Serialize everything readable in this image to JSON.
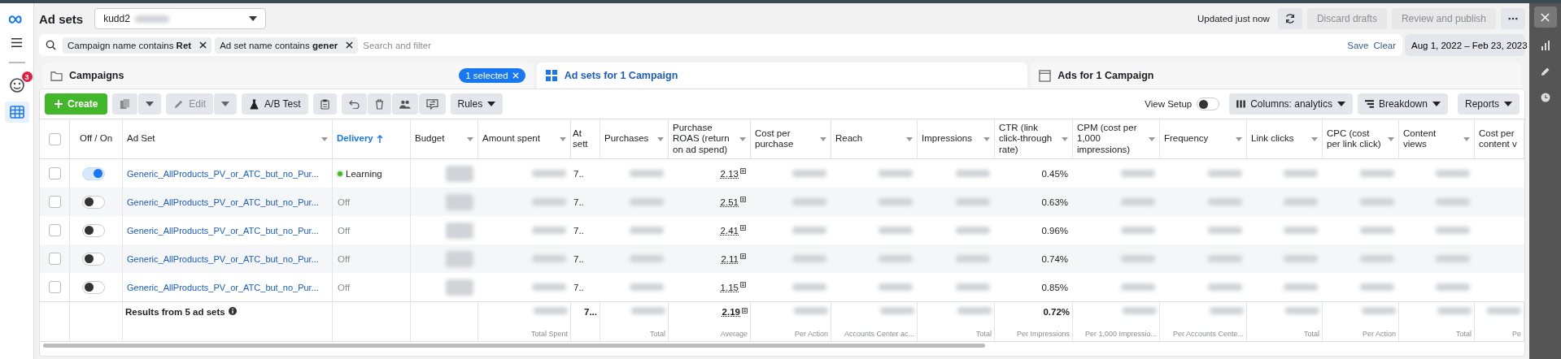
{
  "header": {
    "title": "Ad sets",
    "account": "kudd2",
    "status": "Updated just now",
    "buttons": [
      {
        "label": "Discard drafts",
        "disabled": true
      },
      {
        "label": "Review and publish",
        "disabled": true
      }
    ]
  },
  "left_nav": {
    "notification_badge": "3"
  },
  "filter": {
    "chips": [
      {
        "text": "Campaign name contains **Ret**"
      },
      {
        "text": "Ad set name contains **gener**"
      }
    ],
    "placeholder": "Search and filter",
    "links": [
      "Save",
      "Clear"
    ]
  },
  "date_range": "Aug 1, 2022 – Feb 23, 2023",
  "tabs": [
    {
      "label": "Campaigns",
      "selected": false,
      "badge": "1 selected"
    },
    {
      "label": "Ad sets for 1 Campaign",
      "selected": true
    },
    {
      "label": "Ads for 1 Campaign",
      "selected": false
    }
  ],
  "toolbar": {
    "create": "Create",
    "edit": {
      "label": "Edit",
      "disabled": true
    },
    "ab_test": "A/B Test",
    "rules": "Rules",
    "view_setup": {
      "label": "View Setup",
      "on": false
    },
    "columns": "Columns: analytics",
    "breakdown": "Breakdown",
    "reports": "Reports"
  },
  "columns": [
    {
      "label": "Off / On",
      "sorted": false,
      "menu": false
    },
    {
      "label": "Ad Set",
      "sorted": false,
      "menu": true
    },
    {
      "label": "Delivery",
      "sorted": true,
      "menu": false
    },
    {
      "label": "Budget",
      "sorted": false,
      "menu": true
    },
    {
      "label": "Amount spent",
      "sorted": false,
      "menu": true,
      "total": {
        "note": "Total Spent"
      }
    },
    {
      "label": "At sett",
      "sorted": false,
      "menu": false,
      "total": {
        "value": "7..."
      }
    },
    {
      "label": "Purchases",
      "sorted": false,
      "menu": true,
      "total": {
        "note": "Total"
      }
    },
    {
      "label": "Purchase ROAS (return on ad spend)",
      "sorted": false,
      "menu": true,
      "total": {
        "value": "2.19",
        "note": "Average"
      }
    },
    {
      "label": "Cost per purchase",
      "sorted": false,
      "menu": true,
      "total": {
        "note": "Per Action"
      }
    },
    {
      "label": "Reach",
      "sorted": false,
      "menu": true,
      "total": {
        "note": "Accounts Center ac..."
      }
    },
    {
      "label": "Impressions",
      "sorted": false,
      "menu": true,
      "total": {
        "note": "Total"
      }
    },
    {
      "label": "CTR (link click-through rate)",
      "sorted": false,
      "menu": true,
      "total": {
        "value": "0.72%",
        "note": "Per Impressions"
      }
    },
    {
      "label": "CPM (cost per 1,000 impressions)",
      "sorted": false,
      "menu": true,
      "total": {
        "note": "Per 1,000 Impressio..."
      }
    },
    {
      "label": "Frequency",
      "sorted": false,
      "menu": true,
      "total": {
        "note": "Per Accounts Cente..."
      }
    },
    {
      "label": "Link clicks",
      "sorted": false,
      "menu": true,
      "total": {
        "note": "Total"
      }
    },
    {
      "label": "CPC (cost per link click)",
      "sorted": false,
      "menu": true,
      "total": {
        "note": "Per Action"
      }
    },
    {
      "label": "Content views",
      "sorted": false,
      "menu": true,
      "total": {
        "note": "Total"
      }
    },
    {
      "label": "Cost per content v",
      "sorted": false,
      "menu": false,
      "total": {
        "note": "Pe"
      }
    }
  ],
  "rows": [
    {
      "selected": false,
      "on": true,
      "name": "Generic_AllProducts_PV_or_ATC_but_no_Pur...",
      "delivery": "Learning",
      "delivery_active": true,
      "attribution": "7..",
      "roas": "2.13",
      "ctr": "0.45%"
    },
    {
      "selected": false,
      "on": false,
      "name": "Generic_AllProducts_PV_or_ATC_but_no_Pur...",
      "delivery": "Off",
      "delivery_active": false,
      "attribution": "7..",
      "roas": "2.51",
      "ctr": "0.63%"
    },
    {
      "selected": false,
      "on": false,
      "name": "Generic_AllProducts_PV_or_ATC_but_no_Pur...",
      "delivery": "Off",
      "delivery_active": false,
      "attribution": "7..",
      "roas": "2.41",
      "ctr": "0.96%"
    },
    {
      "selected": false,
      "on": false,
      "name": "Generic_AllProducts_PV_or_ATC_but_no_Pur...",
      "delivery": "Off",
      "delivery_active": false,
      "attribution": "7..",
      "roas": "2.11",
      "ctr": "0.74%"
    },
    {
      "selected": false,
      "on": false,
      "name": "Generic_AllProducts_PV_or_ATC_but_no_Pur...",
      "delivery": "Off",
      "delivery_active": false,
      "attribution": "7..",
      "roas": "1.15",
      "ctr": "0.85%"
    }
  ],
  "select_all_checked": false,
  "totals": {
    "label": "Results from 5 ad sets"
  }
}
